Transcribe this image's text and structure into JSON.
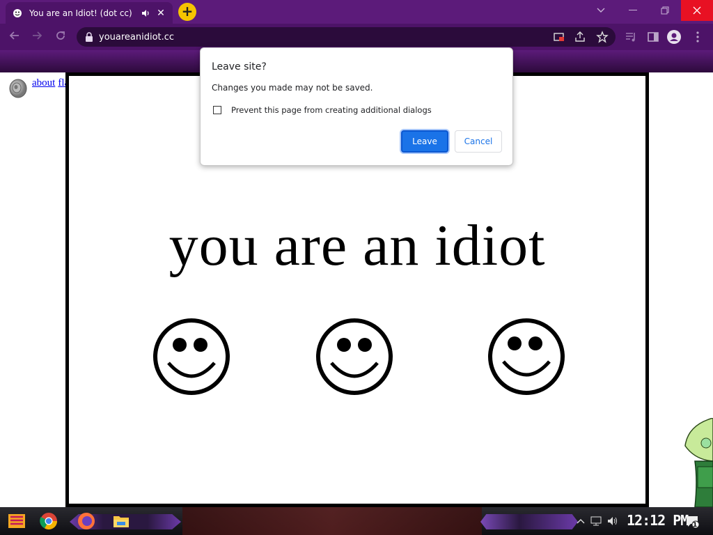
{
  "browser": {
    "tab_title": "You are an Idiot! (dot cc)",
    "url": "youareanidiot.cc",
    "new_tab_label": "+",
    "tab_close_label": "✕",
    "icons": [
      "smiley-favicon",
      "audio-playing-icon",
      "close-icon",
      "chevron-down-icon",
      "minimize-icon",
      "restore-icon",
      "close-window-icon",
      "back-icon",
      "forward-icon",
      "reload-icon",
      "lock-icon",
      "cast-icon",
      "share-icon",
      "star-icon",
      "media-icon",
      "side-panel-icon",
      "profile-icon",
      "menu-icon"
    ],
    "accent_color": "#5c1b7a"
  },
  "page": {
    "links": [
      "about",
      "flash"
    ],
    "headline": "you are an idiot",
    "smiley_count": 3
  },
  "dialog": {
    "title": "Leave site?",
    "message": "Changes you made may not be saved.",
    "checkbox_label": "Prevent this page from creating additional dialogs",
    "checkbox_checked": false,
    "primary_button": "Leave",
    "secondary_button": "Cancel",
    "primary_color": "#1a73e8"
  },
  "taskbar": {
    "clock": "12:12 PM",
    "notification_count": "1"
  }
}
